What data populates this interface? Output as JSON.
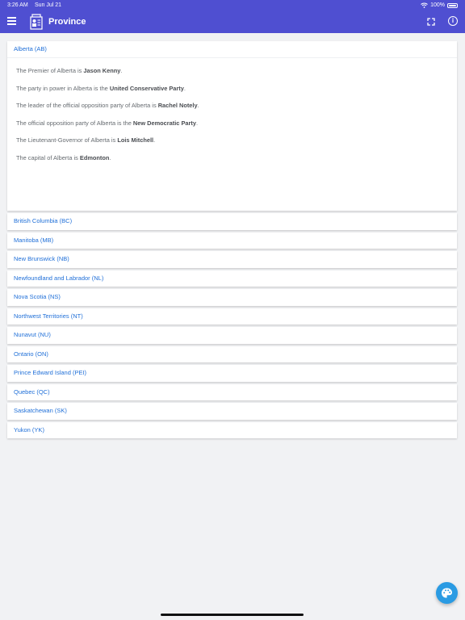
{
  "status": {
    "time": "3:26 AM",
    "date": "Sun Jul 21",
    "battery": "100%"
  },
  "header": {
    "title": "Province"
  },
  "expanded": {
    "label": "Alberta (AB)",
    "facts": [
      {
        "pre": "The Premier of Alberta is ",
        "value": "Jason Kenny",
        "post": "."
      },
      {
        "pre": "The party in power in Alberta is the ",
        "value": "United Conservative Party",
        "post": "."
      },
      {
        "pre": "The leader of the official opposition party of Alberta is ",
        "value": "Rachel Notely",
        "post": "."
      },
      {
        "pre": "The official opposition party of Alberta is the ",
        "value": "New Democratic Party",
        "post": "."
      },
      {
        "pre": "The Lieutenant-Governor of Alberta is ",
        "value": "Lois Mitchell",
        "post": "."
      },
      {
        "pre": "The capital of Alberta is ",
        "value": "Edmonton",
        "post": "."
      }
    ]
  },
  "provinces": [
    "British Columbia (BC)",
    "Manitoba (MB)",
    "New Brunswick (NB)",
    "Newfoundland and Labrador (NL)",
    "Nova Scotia (NS)",
    "Northwest Territories (NT)",
    "Nunavut (NU)",
    "Ontario (ON)",
    "Prince Edward Island (PEI)",
    "Quebec (QC)",
    "Saskatchewan (SK)",
    "Yukon (YK)"
  ],
  "icons": {
    "menu": "menu-icon",
    "logo": "province-logo-icon",
    "expand": "expand-icon",
    "info": "info-icon",
    "palette": "palette-icon"
  },
  "colors": {
    "header": "#4f4fd1",
    "link": "#1f6fd8",
    "fab": "#2a9be3"
  }
}
